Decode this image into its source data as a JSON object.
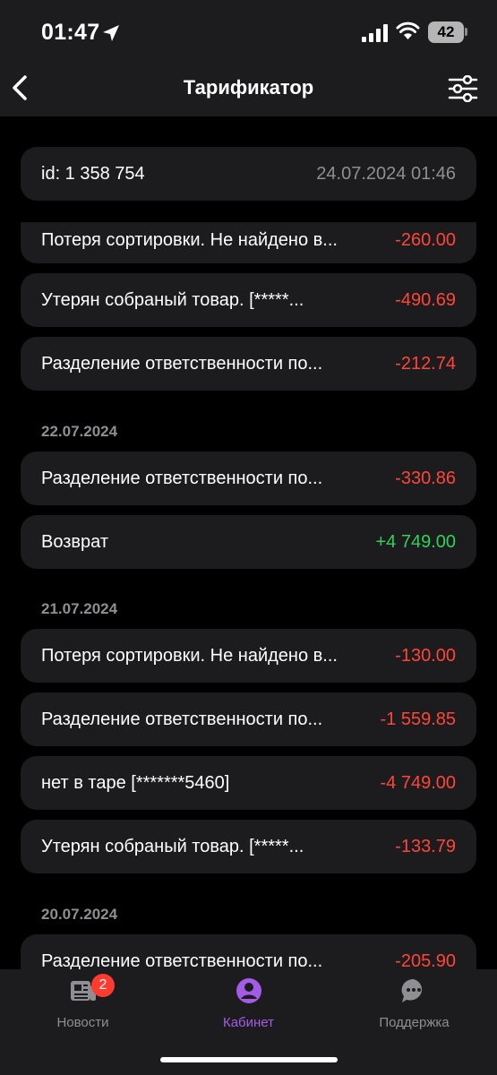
{
  "status_bar": {
    "time": "01:47",
    "battery": "42"
  },
  "nav": {
    "title": "Тарификатор"
  },
  "header_card": {
    "id_label": "id: 1 358 754",
    "datetime": "24.07.2024 01:46"
  },
  "groups": [
    {
      "date": "",
      "rows": [
        {
          "label": "Потеря сортировки. Не найдено в...",
          "amount": "-260.00"
        },
        {
          "label": "Утерян собраный товар. [*****...",
          "amount": "-490.69"
        },
        {
          "label": "Разделение ответственности по...",
          "amount": "-212.74"
        }
      ]
    },
    {
      "date": "22.07.2024",
      "rows": [
        {
          "label": "Разделение ответственности по...",
          "amount": "-330.86"
        },
        {
          "label": "Возврат",
          "amount": "+4 749.00"
        }
      ]
    },
    {
      "date": "21.07.2024",
      "rows": [
        {
          "label": "Потеря сортировки. Не найдено в...",
          "amount": "-130.00"
        },
        {
          "label": "Разделение ответственности по...",
          "amount": "-1 559.85"
        },
        {
          "label": "нет в таре [*******5460]",
          "amount": "-4 749.00"
        },
        {
          "label": "Утерян собраный товар. [*****...",
          "amount": "-133.79"
        }
      ]
    },
    {
      "date": "20.07.2024",
      "rows": [
        {
          "label": "Разделение ответственности по...",
          "amount": "-205.90"
        }
      ]
    }
  ],
  "tabs": [
    {
      "label": "Новости",
      "icon": "news-icon",
      "badge": "2"
    },
    {
      "label": "Кабинет",
      "icon": "profile-icon",
      "active": true
    },
    {
      "label": "Поддержка",
      "icon": "chat-icon"
    }
  ],
  "colors": {
    "negative": "#ff453a",
    "positive": "#30d158",
    "accent": "#a45ce6",
    "card": "#1c1c1e"
  }
}
